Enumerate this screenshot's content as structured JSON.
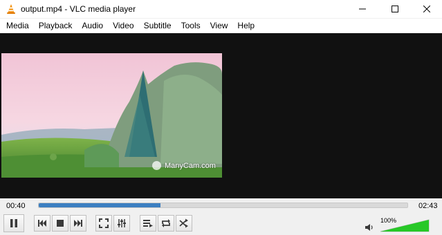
{
  "window": {
    "title": "output.mp4 - VLC media player",
    "controls": [
      "minimize",
      "maximize",
      "close"
    ]
  },
  "menu": {
    "items": [
      "Media",
      "Playback",
      "Audio",
      "Video",
      "Subtitle",
      "Tools",
      "View",
      "Help"
    ]
  },
  "video": {
    "watermark": "ManyCam.com"
  },
  "seek": {
    "elapsed": "00:40",
    "total": "02:43",
    "progress": 0.33
  },
  "controls": {
    "buttons": [
      "pause",
      "previous",
      "stop",
      "next",
      "fullscreen",
      "extended-settings",
      "playlist",
      "loop",
      "random"
    ]
  },
  "volume": {
    "label": "100%",
    "level": 1.0,
    "accent": "#27c827"
  },
  "colors": {
    "seek_fill": "#3c7fc1",
    "video_bg": "#111111",
    "vlc_cone": "#f28c00"
  }
}
